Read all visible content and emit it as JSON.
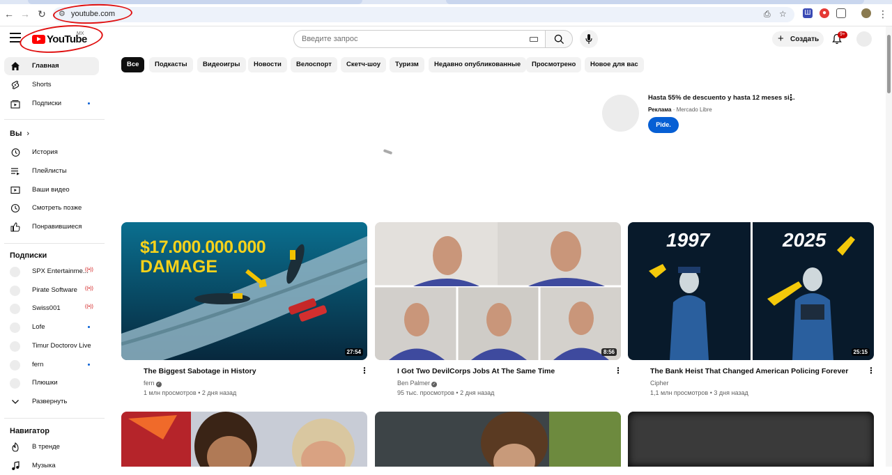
{
  "browser": {
    "url": "youtube.com",
    "notifications_badge": "9+"
  },
  "masthead": {
    "logo_text": "YouTube",
    "country_code": "MX",
    "search_placeholder": "Введите запрос",
    "create_label": "Создать"
  },
  "sidebar": {
    "main": [
      {
        "label": "Главная",
        "icon": "home-icon",
        "active": true
      },
      {
        "label": "Shorts",
        "icon": "shorts-icon"
      },
      {
        "label": "Подписки",
        "icon": "subscriptions-icon",
        "dot": true
      }
    ],
    "you_header": "Вы",
    "you": [
      {
        "label": "История",
        "icon": "history-icon"
      },
      {
        "label": "Плейлисты",
        "icon": "playlists-icon"
      },
      {
        "label": "Ваши видео",
        "icon": "your-videos-icon"
      },
      {
        "label": "Смотреть позже",
        "icon": "watch-later-icon"
      },
      {
        "label": "Понравившиеся",
        "icon": "like-icon"
      }
    ],
    "subs_header": "Подписки",
    "subs": [
      {
        "label": "SPX Entertainme...",
        "live": true
      },
      {
        "label": "Pirate Software",
        "live": true
      },
      {
        "label": "Swiss001",
        "live": true
      },
      {
        "label": "Lofe",
        "dot": true
      },
      {
        "label": "Timur Doctorov Live"
      },
      {
        "label": "fern",
        "dot": true
      },
      {
        "label": "Плюшки"
      }
    ],
    "expand_label": "Развернуть",
    "nav_header": "Навигатор",
    "nav": [
      {
        "label": "В тренде",
        "icon": "trending-icon"
      },
      {
        "label": "Музыка",
        "icon": "music-icon"
      }
    ]
  },
  "chips": [
    "Все",
    "Подкасты",
    "Видеоигры",
    "Новости",
    "Велоспорт",
    "Скетч-шоу",
    "Туризм",
    "Недавно опубликованные",
    "Просмотрено",
    "Новое для вас"
  ],
  "ad": {
    "title": "Hasta 55% de descuento y hasta 12 meses si...",
    "label": "Реклама",
    "advertiser": "Mercado Libre",
    "button": "Pide."
  },
  "videos": [
    {
      "title": "The Biggest Sabotage in History",
      "channel": "fern",
      "verified": true,
      "views": "1 млн просмотров",
      "age": "2 дня назад",
      "duration": "27:54",
      "thumb_text_1": "$17.000.000.000",
      "thumb_text_2": "DAMAGE"
    },
    {
      "title": "I Got Two DevilCorps Jobs At The Same Time",
      "channel": "Ben Palmer",
      "verified": true,
      "views": "95 тыс. просмотров",
      "age": "2 дня назад",
      "duration": "8:56"
    },
    {
      "title": "The Bank Heist That Changed American Policing Forever",
      "channel": "Cipher",
      "verified": false,
      "views": "1,1 млн просмотров",
      "age": "3 дня назад",
      "duration": "25:15",
      "thumb_text_1": "1997",
      "thumb_text_2": "2025"
    }
  ],
  "colors": {
    "brand_red": "#ff0000",
    "accent_blue": "#065fd4",
    "annotation_red": "#e01010"
  }
}
